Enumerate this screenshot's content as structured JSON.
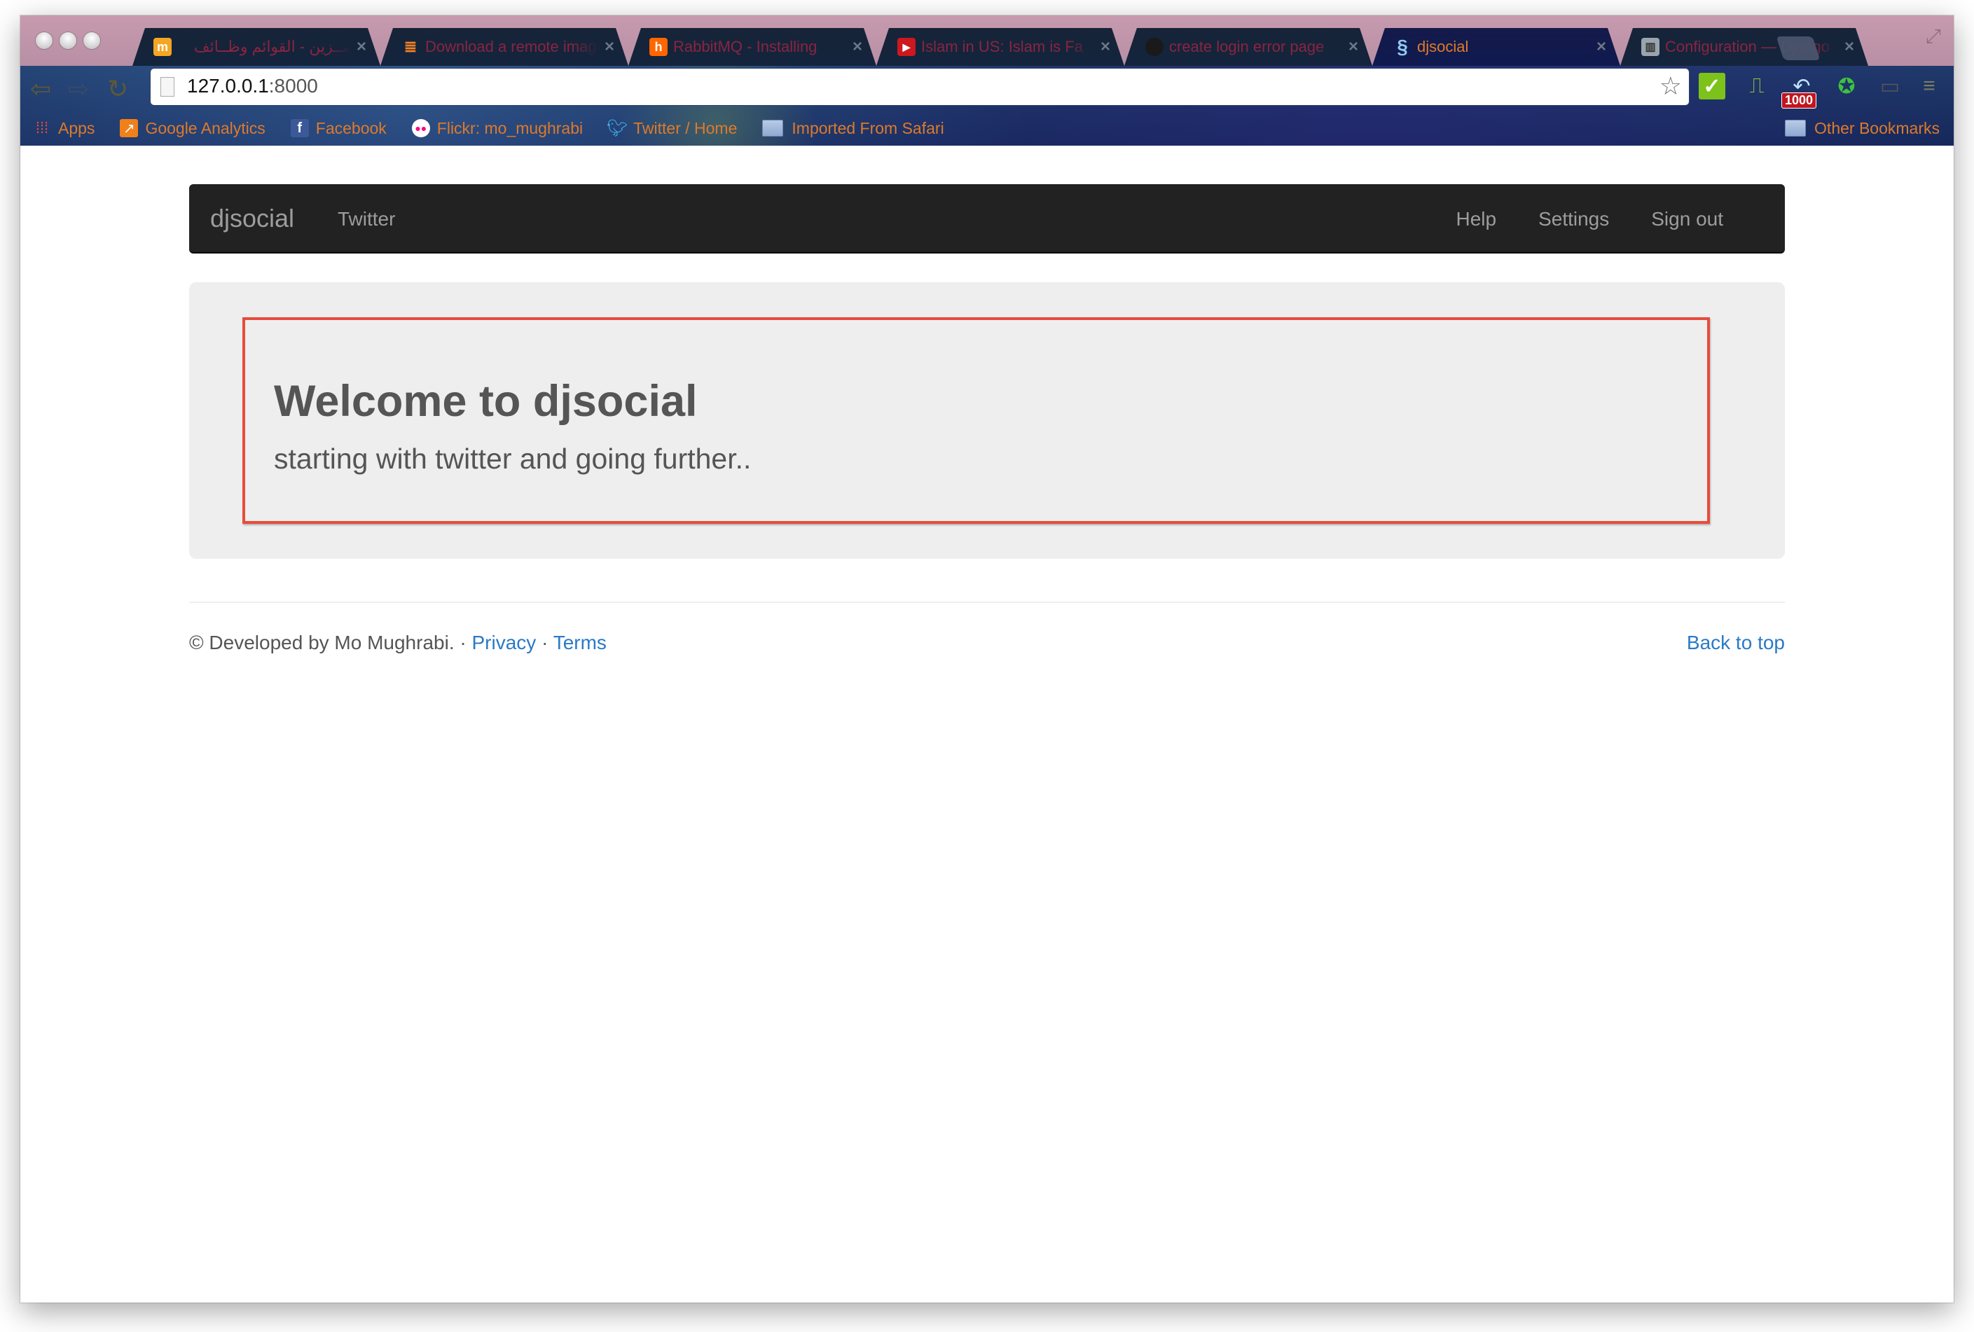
{
  "browser": {
    "tabs": [
      {
        "title": "مــزين - القوائم وظــائف",
        "icon": "mezzin-icon",
        "icon_color": "#f5a623",
        "active": false
      },
      {
        "title": "Download a remote image",
        "icon": "stackoverflow-icon",
        "icon_color": "#f48024",
        "active": false
      },
      {
        "title": "RabbitMQ - Installing",
        "icon": "rabbitmq-icon",
        "icon_color": "#ff6600",
        "active": false
      },
      {
        "title": "Islam in US: Islam is Fa",
        "icon": "youtube-icon",
        "icon_color": "#cc181e",
        "active": false
      },
      {
        "title": "create login error page",
        "icon": "github-icon",
        "icon_color": "#333333",
        "active": false
      },
      {
        "title": "djsocial",
        "icon": "django-snake-icon",
        "icon_color": "#8ec9f0",
        "active": true
      },
      {
        "title": "Configuration — Django",
        "icon": "docs-icon",
        "icon_color": "#9aa4ae",
        "active": false
      }
    ],
    "url_host": "127.0.0.1",
    "url_port": ":8000",
    "extension_badge": "1000",
    "bookmarks": [
      {
        "label": "Apps",
        "icon": "apps-grid-icon"
      },
      {
        "label": "Google Analytics",
        "icon": "analytics-icon"
      },
      {
        "label": "Facebook",
        "icon": "facebook-icon"
      },
      {
        "label": "Flickr: mo_mughrabi",
        "icon": "flickr-icon"
      },
      {
        "label": "Twitter / Home",
        "icon": "twitter-icon"
      },
      {
        "label": "Imported From Safari",
        "icon": "folder-icon"
      }
    ],
    "other_bookmarks": "Other Bookmarks"
  },
  "navbar": {
    "brand": "djsocial",
    "left_links": [
      "Twitter"
    ],
    "right_links": [
      "Help",
      "Settings",
      "Sign out"
    ]
  },
  "jumbotron": {
    "heading": "Welcome to djsocial",
    "tagline": "starting with twitter and going further.."
  },
  "footer": {
    "credit": "© Developed by Mo Mughrabi.",
    "separator": " · ",
    "privacy": "Privacy",
    "terms": "Terms",
    "back_to_top": "Back to top"
  },
  "colors": {
    "navbar_bg": "#222222",
    "jumbotron_bg": "#eeeeee",
    "highlight_border": "#e74c3c",
    "link": "#2a7ac6",
    "bookmark_text": "#de7a2a"
  }
}
